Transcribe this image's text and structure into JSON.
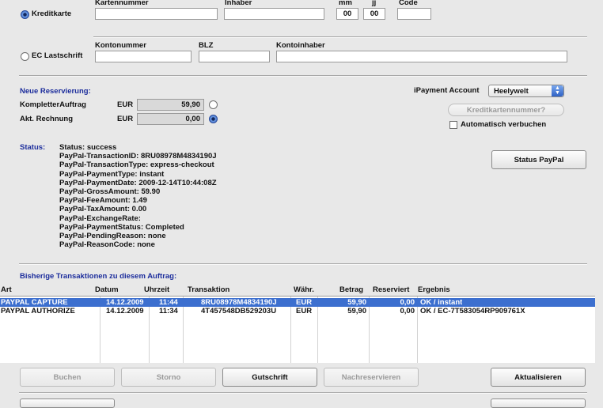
{
  "credit_card": {
    "radio_label": "Kreditkarte",
    "headers": {
      "number": "Kartennummer",
      "holder": "Inhaber",
      "month": "mm",
      "year": "jj",
      "code": "Code"
    },
    "values": {
      "number": "",
      "holder": "",
      "month": "00",
      "year": "00",
      "code": ""
    }
  },
  "ec": {
    "radio_label": "EC Lastschrift",
    "headers": {
      "account": "Kontonummer",
      "blz": "BLZ",
      "owner": "Kontoinhaber"
    }
  },
  "reservation": {
    "title": "Neue Reservierung:",
    "rows": [
      {
        "label": "KompletterAuftrag",
        "currency": "EUR",
        "amount": "59,90",
        "selected": false
      },
      {
        "label": "Akt. Rechnung",
        "currency": "EUR",
        "amount": "0,00",
        "selected": true
      }
    ],
    "account_label": "iPayment Account",
    "account_value": "Heelywelt",
    "cc_button": "Kreditkartennummer?",
    "auto_label": "Automatisch verbuchen"
  },
  "status": {
    "label": "Status:",
    "lines": [
      "Status: success",
      "PayPal-TransactionID: 8RU08978M4834190J",
      "PayPal-TransactionType: express-checkout",
      "PayPal-PaymentType: instant",
      "PayPal-PaymentDate: 2009-12-14T10:44:08Z",
      "PayPal-GrossAmount: 59.90",
      "PayPal-FeeAmount: 1.49",
      "PayPal-TaxAmount: 0.00",
      "PayPal-ExchangeRate:",
      "PayPal-PaymentStatus: Completed",
      "PayPal-PendingReason: none",
      "PayPal-ReasonCode: none"
    ],
    "button": "Status PayPal"
  },
  "transactions": {
    "title": "Bisherige Transaktionen zu diesem Auftrag:",
    "columns": [
      "Art",
      "Datum",
      "Uhrzeit",
      "Transaktion",
      "Währ.",
      "Betrag",
      "Reserviert",
      "Ergebnis"
    ],
    "rows": [
      [
        "PAYPAL CAPTURE",
        "14.12.2009",
        "11:44",
        "8RU08978M4834190J",
        "EUR",
        "59,90",
        "0,00",
        "OK / instant"
      ],
      [
        "PAYPAL AUTHORIZE",
        "14.12.2009",
        "11:34",
        "4T457548DB529203U",
        "EUR",
        "59,90",
        "0,00",
        "OK / EC-7T583054RP909761X"
      ]
    ],
    "selected_row": 0
  },
  "buttons": {
    "book": "Buchen",
    "cancel": "Storno",
    "credit": "Gutschrift",
    "rereserve": "Nachreservieren",
    "refresh": "Aktualisieren"
  },
  "colors": {
    "accent_blue": "#1c2d9c",
    "selection": "#3c6fcf"
  }
}
